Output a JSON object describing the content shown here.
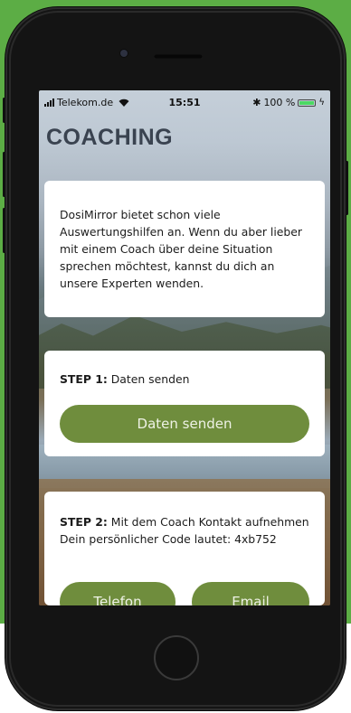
{
  "status_bar": {
    "carrier": "Telekom.de",
    "time": "15:51",
    "battery": "100 %"
  },
  "page": {
    "title": "COACHING"
  },
  "intro": {
    "text": "DosiMirror bietet schon viele Auswertungshilfen an. Wenn du aber lieber mit einem Coach über deine Situation sprechen möchtest, kannst du dich an unsere Experten wenden."
  },
  "step1": {
    "label": "STEP 1:",
    "text": " Daten senden",
    "button": "Daten senden"
  },
  "step2": {
    "label": "STEP 2:",
    "text": " Mit dem Coach Kontakt aufnehmen Dein persönlicher Code lautet: 4xb752",
    "phone_button": "Telefon",
    "email_button": "Email"
  },
  "colors": {
    "accent": "#6f8d3d",
    "background": "#5cad45",
    "title": "#3a4350"
  },
  "icons": [
    "signal-icon",
    "wifi-icon",
    "bluetooth-icon",
    "battery-icon",
    "charging-icon"
  ]
}
